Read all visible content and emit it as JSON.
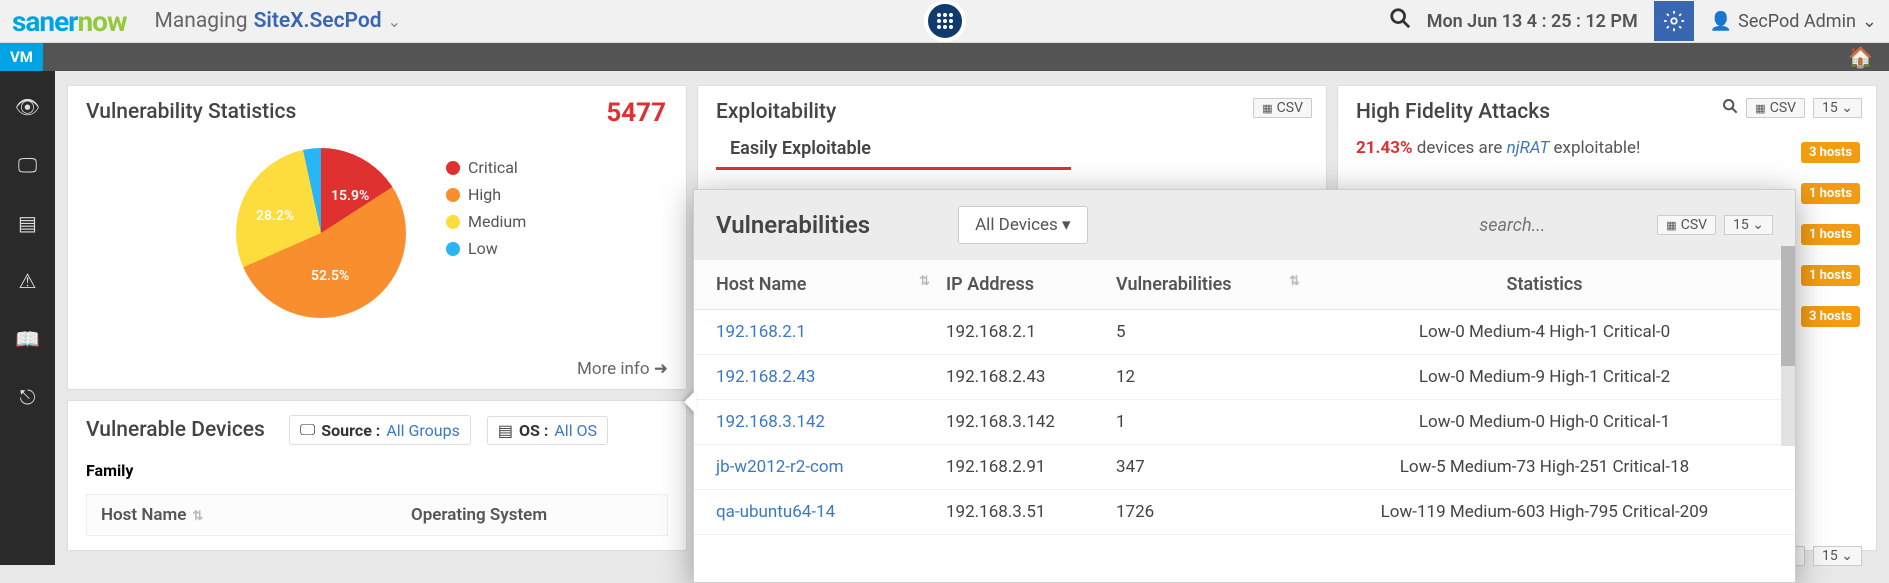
{
  "header": {
    "logo": {
      "part1": "saner",
      "part2": "now"
    },
    "managing_label": "Managing",
    "site": "SiteX.SecPod",
    "time": "Mon Jun 13  4 : 25 : 12 PM",
    "user": "SecPod Admin"
  },
  "nav": {
    "vm_label": "VM"
  },
  "vuln_stats": {
    "title": "Vulnerability Statistics",
    "total": "5477",
    "slices": {
      "critical": "15.9%",
      "high": "52.5%",
      "medium": "28.2%"
    },
    "legend": {
      "critical": "Critical",
      "high": "High",
      "medium": "Medium",
      "low": "Low"
    },
    "more_info": "More info"
  },
  "vuln_devices": {
    "title": "Vulnerable Devices",
    "source_label": "Source :",
    "source_value": "All Groups",
    "os_label": "OS :",
    "os_value": "All OS",
    "family_label": "Family",
    "cols": {
      "host": "Host Name",
      "os": "Operating System"
    }
  },
  "exploit": {
    "title": "Exploitability",
    "csv": "CSV",
    "easy": "Easily Exploitable"
  },
  "hifi": {
    "title": "High Fidelity Attacks",
    "csv": "CSV",
    "page": "15",
    "pct": "21.43%",
    "text_mid": " devices are ",
    "njrat": "njRAT",
    "text_end": " exploitable!",
    "badges": [
      "3 hosts",
      "1 hosts",
      "1 hosts",
      "1 hosts",
      "3 hosts"
    ]
  },
  "popup": {
    "title": "Vulnerabilities",
    "dropdown": "All Devices",
    "search_placeholder": "search...",
    "csv": "CSV",
    "page": "15",
    "cols": {
      "host": "Host Name",
      "ip": "IP Address",
      "vuln": "Vulnerabilities",
      "stats": "Statistics"
    },
    "rows": [
      {
        "host": "192.168.2.1",
        "ip": "192.168.2.1",
        "vuln": "5",
        "stats": "Low-0 Medium-4 High-1 Critical-0"
      },
      {
        "host": "192.168.2.43",
        "ip": "192.168.2.43",
        "vuln": "12",
        "stats": "Low-0 Medium-9 High-1 Critical-2"
      },
      {
        "host": "192.168.3.142",
        "ip": "192.168.3.142",
        "vuln": "1",
        "stats": "Low-0 Medium-0 High-0 Critical-1"
      },
      {
        "host": "jb-w2012-r2-com",
        "ip": "192.168.2.91",
        "vuln": "347",
        "stats": "Low-5 Medium-73 High-251 Critical-18"
      },
      {
        "host": "qa-ubuntu64-14",
        "ip": "192.168.3.51",
        "vuln": "1726",
        "stats": "Low-119 Medium-603 High-795 Critical-209"
      }
    ]
  },
  "chart_data": {
    "type": "pie",
    "title": "Vulnerability Statistics",
    "total": 5477,
    "categories": [
      "Critical",
      "High",
      "Medium",
      "Low"
    ],
    "values_pct": [
      15.9,
      52.5,
      28.2,
      3.4
    ],
    "colors": [
      "#e03131",
      "#f98e2e",
      "#fddc3d",
      "#29b6f6"
    ]
  }
}
